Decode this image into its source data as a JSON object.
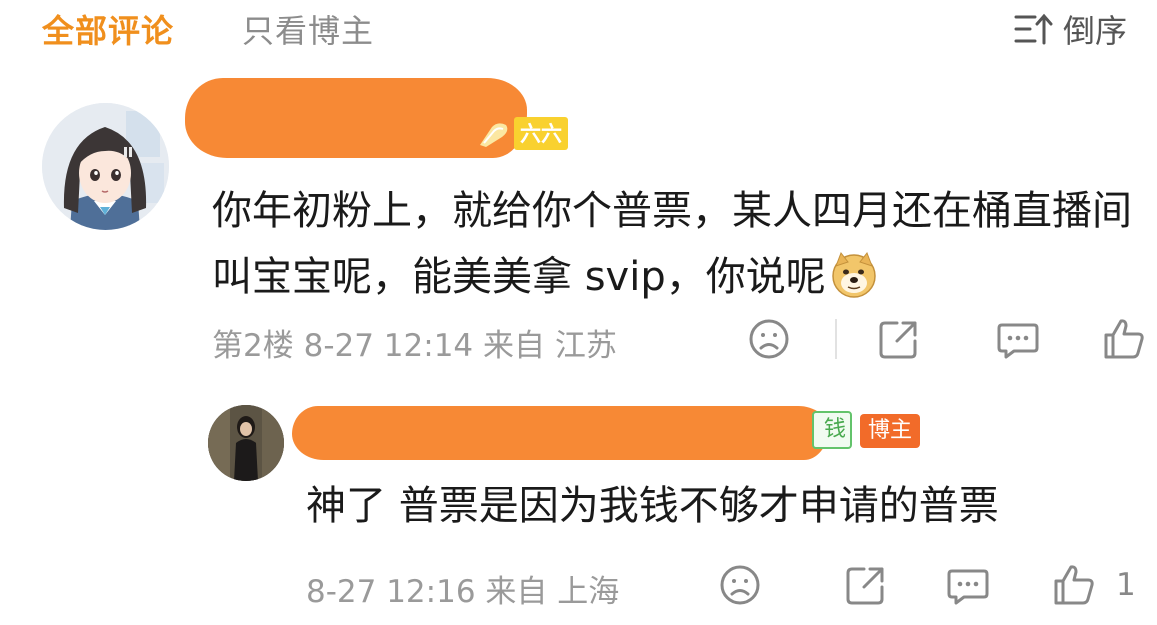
{
  "tabs": {
    "all_comments": "全部评论",
    "blogger_only": "只看博主"
  },
  "sort": {
    "label": "倒序",
    "icon": "sort-icon"
  },
  "colors": {
    "accent": "#f08f1d",
    "tab_inactive": "#8c8c8c",
    "meta_gray": "#9a9a9a",
    "blogger_badge": "#f26b29",
    "level_badge": "#f9d12f",
    "redaction": "#f78935"
  },
  "comments": [
    {
      "level_badge": "六六",
      "text": "你年初粉上，就给你个普票，某人四月还在桶直播间叫宝宝呢，能美美拿 svip，你说呢",
      "emoji": "doge-emoji",
      "floor": "第2楼",
      "time": "8-27 12:14",
      "location": "来自 江苏"
    }
  ],
  "reply": {
    "partial_badge": "钱",
    "blogger_badge": "博主",
    "text": "神了 普票是因为我钱不够才申请的普票",
    "time": "8-27 12:16",
    "location": "来自 上海",
    "like_count": "1"
  }
}
